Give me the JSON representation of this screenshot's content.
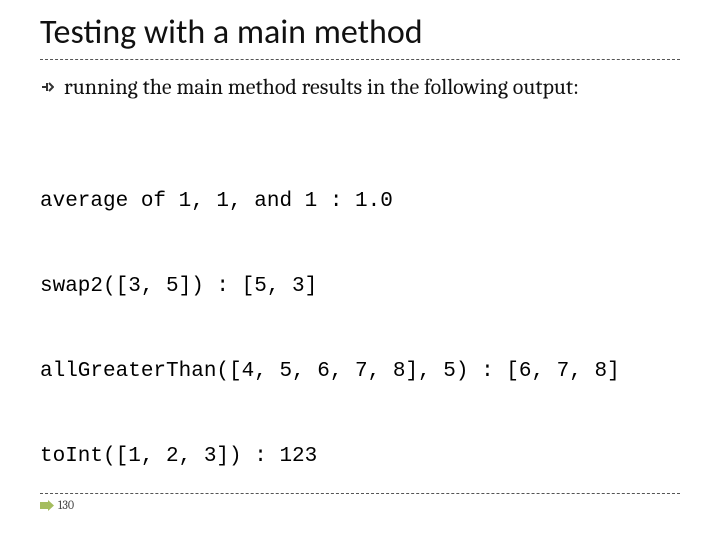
{
  "title": "Testing with a main method",
  "bullet": "running the main method results in the following output:",
  "code_lines": [
    "average of 1, 1, and 1 : 1.0",
    "swap2([3, 5]) : [5, 3]",
    "allGreaterThan([4, 5, 6, 7, 8], 5) : [6, 7, 8]",
    "toInt([1, 2, 3]) : 123"
  ],
  "page_number": "130"
}
